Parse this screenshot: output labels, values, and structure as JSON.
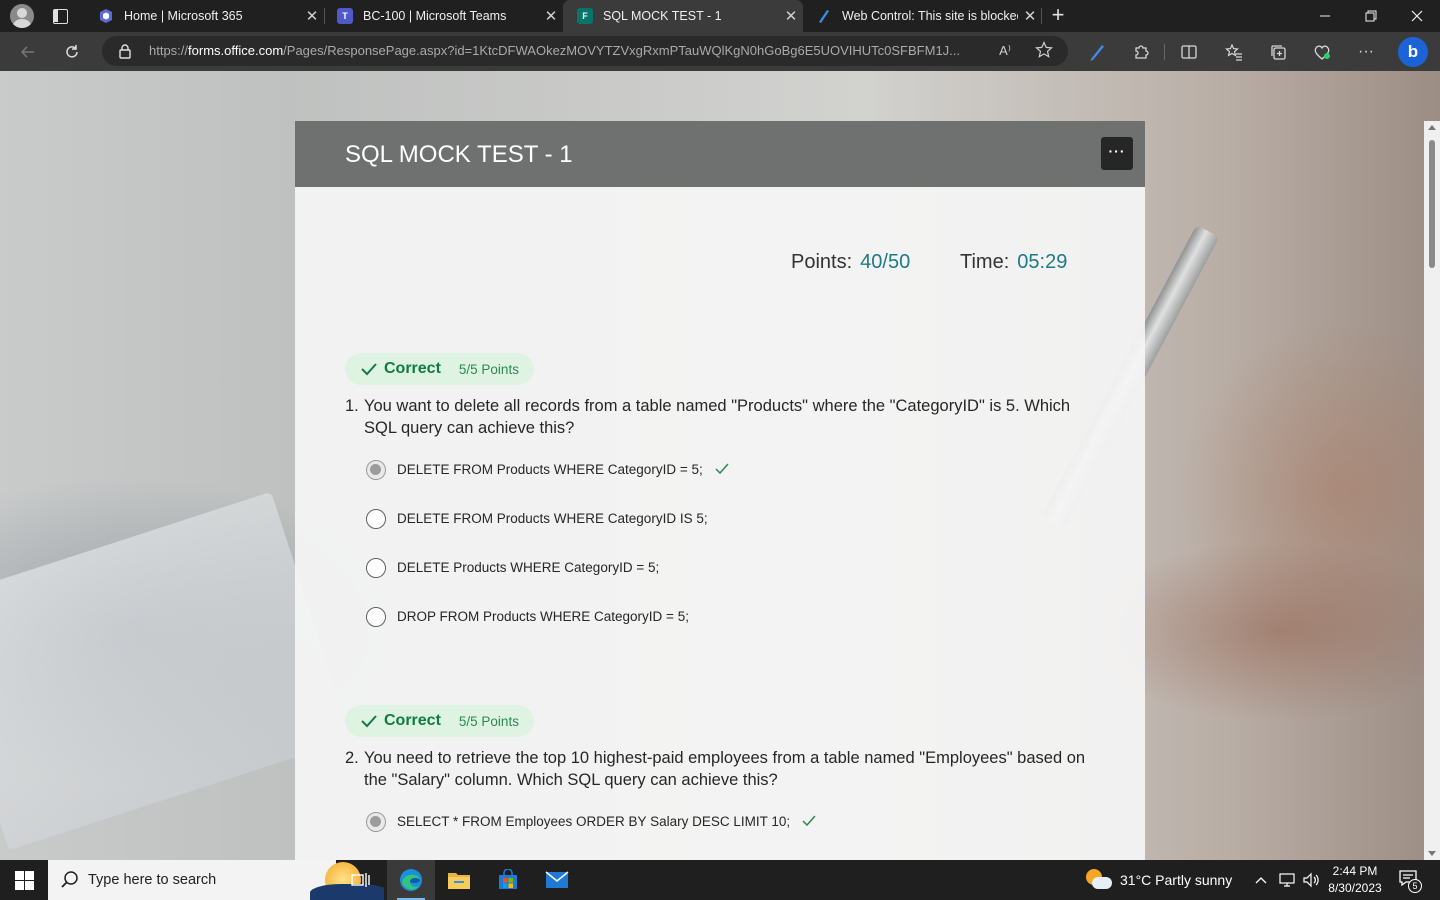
{
  "browser": {
    "tabs": [
      {
        "title": "Home | Microsoft 365",
        "icon": "microsoft365-icon",
        "active": false
      },
      {
        "title": "BC-100 | Microsoft Teams",
        "icon": "teams-icon",
        "active": false
      },
      {
        "title": "SQL MOCK TEST - 1",
        "icon": "forms-icon",
        "active": true
      },
      {
        "title": "Web Control: This site is blocked.",
        "icon": "web-control-icon",
        "active": false
      }
    ],
    "url_prefix": "https://",
    "url_host": "forms.office.com",
    "url_rest": "/Pages/ResponsePage.aspx?id=1KtcDFWAOkezMOVYTZVxgRxmPTauWQlKgN0hGoBg6E5UOVIHUTc0SFBFM1J...",
    "read_aloud_label": "A⁾"
  },
  "form": {
    "title": "SQL MOCK TEST - 1",
    "more_label": "···",
    "points_label": "Points:",
    "points_value": "40/50",
    "time_label": "Time:",
    "time_value": "05:29"
  },
  "questions": [
    {
      "number": "1.",
      "status": "Correct",
      "points": "5/5 Points",
      "text": "You want to delete all records from a table named \"Products\" where the \"CategoryID\" is 5. Which SQL query can achieve this?",
      "options": [
        {
          "text": "DELETE FROM Products WHERE CategoryID = 5;",
          "selected": true,
          "correct": true
        },
        {
          "text": "DELETE FROM Products WHERE CategoryID IS 5;",
          "selected": false,
          "correct": false
        },
        {
          "text": "DELETE Products WHERE CategoryID = 5;",
          "selected": false,
          "correct": false
        },
        {
          "text": "DROP FROM Products WHERE CategoryID = 5;",
          "selected": false,
          "correct": false
        }
      ]
    },
    {
      "number": "2.",
      "status": "Correct",
      "points": "5/5 Points",
      "text": "You need to retrieve the top 10 highest-paid employees from a table named \"Employees\" based on the \"Salary\" column. Which SQL query can achieve this?",
      "options": [
        {
          "text": "SELECT * FROM Employees ORDER BY Salary DESC LIMIT 10;",
          "selected": true,
          "correct": true
        }
      ]
    }
  ],
  "taskbar": {
    "search_placeholder": "Type here to search",
    "apps": [
      "task-view-icon",
      "edge-icon",
      "file-explorer-icon",
      "microsoft-store-icon",
      "mail-icon"
    ],
    "weather": "31°C  Partly sunny",
    "time": "2:44 PM",
    "date": "8/30/2023",
    "notification_count": "5"
  },
  "colors": {
    "accent_teal": "#1e7a85",
    "correct_green": "#107c41",
    "badge_bg": "#dff3e3",
    "header_gray": "#6f7070"
  }
}
